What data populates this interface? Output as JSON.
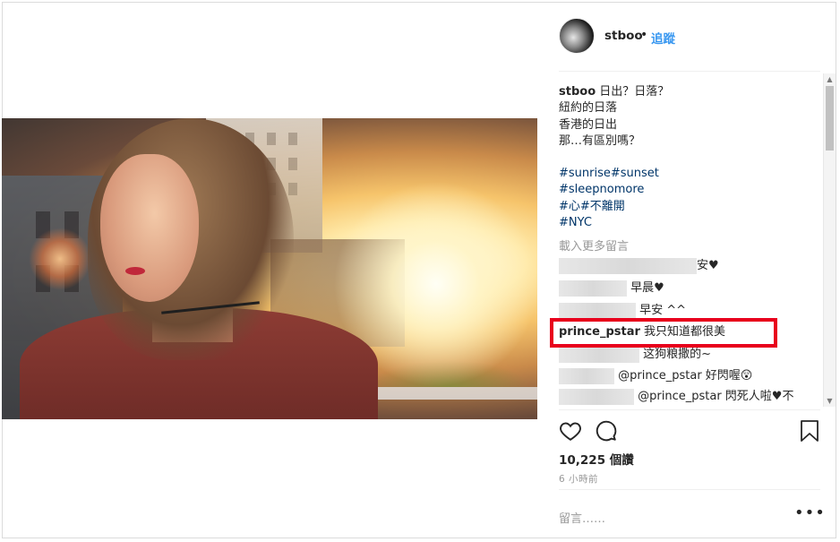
{
  "post": {
    "username": "stboo",
    "separator": "•",
    "follow_label": "追蹤",
    "caption_lines": [
      "日出？日落？",
      "紐約的日落",
      "香港的日出",
      "那…有區別嗎？"
    ],
    "hashtags": [
      "#sunrise#sunset",
      "#sleepnomore",
      "#心#不離開",
      "#NYC"
    ],
    "load_more_label": "載入更多留言",
    "likes": "10,225 個讚",
    "timestamp": "6 小時前",
    "comment_placeholder": "留言……",
    "more_icon": "•••"
  },
  "comments": [
    {
      "text": "安♥"
    },
    {
      "text": "早晨♥"
    },
    {
      "text": "早安 ^^"
    },
    {
      "user": "prince_pstar",
      "text": "我只知道都很美"
    },
    {
      "text": "这狗粮撒的~"
    },
    {
      "text": "@prince_pstar 好閃喔😲"
    },
    {
      "text": "@prince_pstar 閃死人啦♥不"
    }
  ],
  "colors": {
    "link": "#3897f0",
    "highlight_box": "#e8001c",
    "hashtag": "#003569"
  }
}
